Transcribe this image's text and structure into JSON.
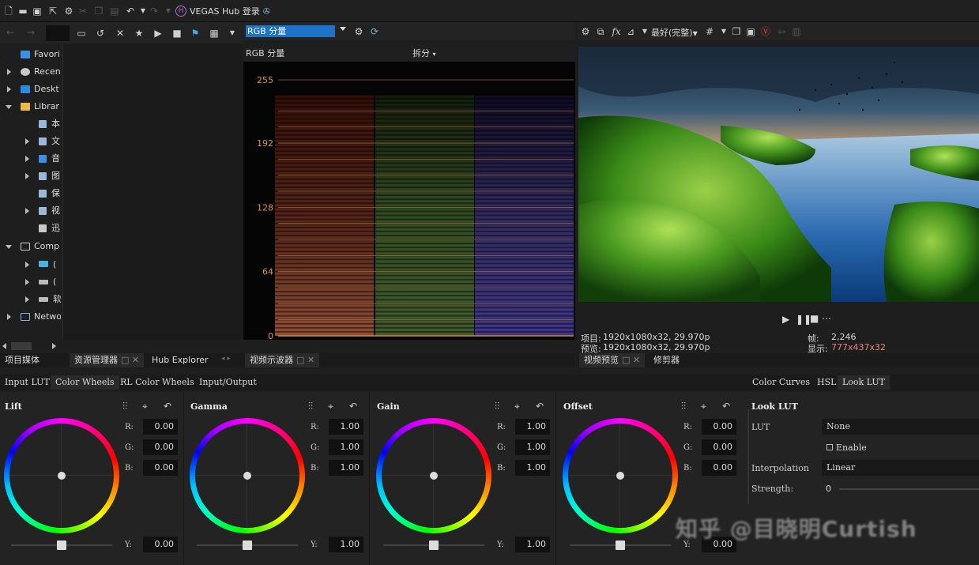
{
  "app": {
    "hub_label": "VEGAS Hub 登录"
  },
  "explorer": {
    "tree": [
      {
        "label": "Favori"
      },
      {
        "label": "Recen"
      },
      {
        "label": "Deskt"
      },
      {
        "label": "Librar"
      },
      {
        "label": "本"
      },
      {
        "label": "文"
      },
      {
        "label": "音"
      },
      {
        "label": "图"
      },
      {
        "label": "保"
      },
      {
        "label": "视"
      },
      {
        "label": "迅"
      },
      {
        "label": "Comp"
      },
      {
        "label": "("
      },
      {
        "label": "("
      },
      {
        "label": "软"
      },
      {
        "label": "Netwo"
      }
    ],
    "tabs": [
      "项目媒体",
      "资源管理器",
      "Hub Explorer"
    ]
  },
  "scope": {
    "mode": "RGB 分量",
    "title": "RGB 分量",
    "split_label": "拆分",
    "tab_label": "视频示波器",
    "y_ticks": [
      "255",
      "192",
      "128",
      "64",
      "0"
    ]
  },
  "preview": {
    "quality": "最好(完整)",
    "project_label": "项目:",
    "project_value": "1920x1080x32, 29.970p",
    "preview_label": "预览:",
    "preview_value": "1920x1080x32, 29.970p",
    "frame_label": "帧:",
    "frame_value": "2,246",
    "display_label": "显示:",
    "display_value": "777x437x32",
    "tabs": [
      "视频预览",
      "修剪器"
    ]
  },
  "color": {
    "tabs": [
      "Input LUT",
      "Color Wheels",
      "RL Color Wheels",
      "Input/Output"
    ],
    "wheels": [
      {
        "name": "Lift",
        "r": "0.00",
        "g": "0.00",
        "b": "0.00",
        "y": "0.00",
        "slider": 0.5
      },
      {
        "name": "Gamma",
        "r": "1.00",
        "g": "1.00",
        "b": "1.00",
        "y": "1.00",
        "slider": 0.5
      },
      {
        "name": "Gain",
        "r": "1.00",
        "g": "1.00",
        "b": "1.00",
        "y": "1.00",
        "slider": 0.5
      },
      {
        "name": "Offset",
        "r": "0.00",
        "g": "0.00",
        "b": "0.00",
        "y": "0.00",
        "slider": 0.5
      }
    ],
    "channel_labels": {
      "r": "R:",
      "g": "G:",
      "b": "B:",
      "y": "Y:"
    }
  },
  "lut": {
    "tabs": [
      "Color Curves",
      "HSL",
      "Look LUT"
    ],
    "title": "Look LUT",
    "lut_label": "LUT",
    "lut_value": "None",
    "enable_label": "Enable",
    "interp_label": "Interpolation",
    "interp_value": "Linear",
    "strength_label": "Strength:",
    "strength_value": "0"
  },
  "watermark": "知乎 @目晓明Curtish",
  "colors": {
    "accent": "#1e72c8",
    "scope_line": "#c8884a",
    "scope_tick": "#d8963c"
  }
}
